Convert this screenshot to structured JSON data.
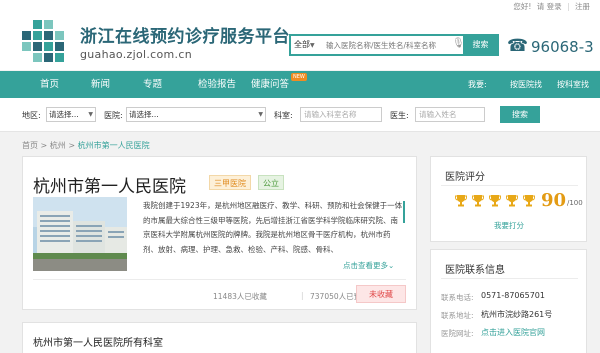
{
  "topbar": {
    "greeting": "您好!",
    "login": "请 登录",
    "register": "注册"
  },
  "header": {
    "site_title": "浙江在线预约诊疗服务平台",
    "site_domain": "guahao.zjol.com.cn",
    "phone": "96068-3",
    "brand_color": "#35a29a"
  },
  "search": {
    "scope": "全部",
    "placeholder": "输入医院名称/医生姓名/科室名称",
    "button": "搜索"
  },
  "nav": {
    "items": [
      {
        "label": "首页"
      },
      {
        "label": "新闻"
      },
      {
        "label": "专题"
      },
      {
        "label": "检验报告"
      },
      {
        "label": "健康问答",
        "badge": "NEW"
      }
    ],
    "right_label": "我要:",
    "right_links": [
      "按医院找",
      "按科室找"
    ]
  },
  "filters": {
    "region_label": "地区:",
    "region_value": "请选择...",
    "hospital_label": "医院:",
    "hospital_value": "请选择...",
    "dept_label": "科室:",
    "dept_placeholder": "请输入科室名称",
    "doctor_label": "医生:",
    "doctor_placeholder": "请输入姓名",
    "button": "搜索"
  },
  "breadcrumb": {
    "home": "首页",
    "city": "杭州",
    "current": "杭州市第一人民医院"
  },
  "hospital": {
    "name": "杭州市第一人民医院",
    "level": "三甲医院",
    "type": "公立",
    "description": "我院创建于1923年，是杭州地区融医疗、教学、科研、预防和社会保健于一体的市属最大综合性三级甲等医院，先后增挂浙江省医学科学院临床研究院、南京医科大学附属杭州医院的牌牌。我院是杭州地区骨干医疗机构，杭州市药剂、放射、病理、护理、急救、检验、产科、院感、骨科、",
    "more": "点击查看更多",
    "favorites": "11483人已收藏",
    "appointments": "737050人已预约",
    "fav_button": "未收藏"
  },
  "departments": {
    "title": "杭州市第一人民医院所有科室"
  },
  "rating": {
    "title": "医院评分",
    "trophies": 5,
    "score": "90",
    "total": "/100",
    "rate_link": "我要打分",
    "trophy_color": "#e8a817"
  },
  "contact": {
    "title": "医院联系信息",
    "phone_label": "联系电话:",
    "phone": "0571-87065701",
    "address_label": "联系地址:",
    "address": "杭州市浣纱路261号",
    "website_label": "医院网址:",
    "website": "点击进入医院官网"
  }
}
